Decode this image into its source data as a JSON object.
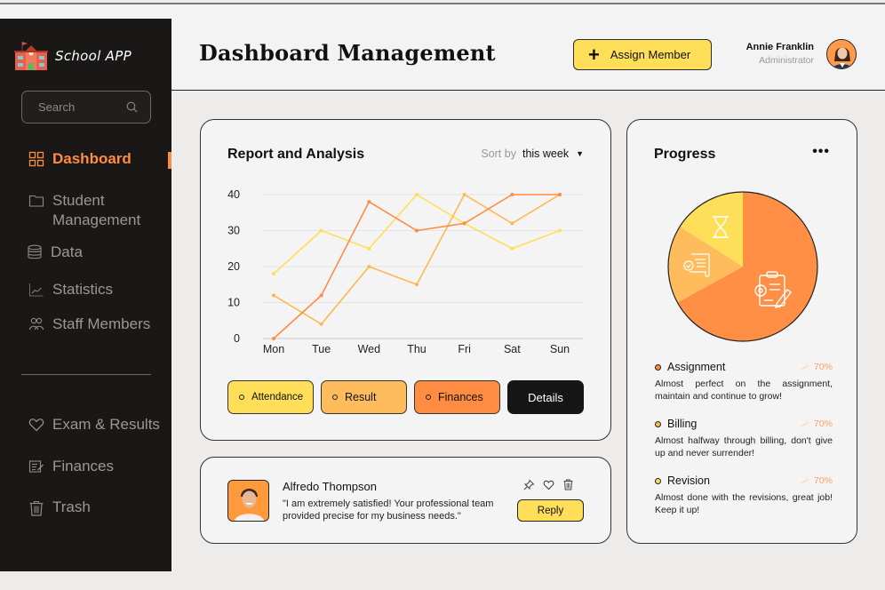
{
  "app": {
    "name": "School APP"
  },
  "sidebar": {
    "search_placeholder": "Search",
    "items": [
      {
        "label": "Dashboard",
        "icon": "grid-icon",
        "active": true
      },
      {
        "label": "Student Management",
        "icon": "folder-icon"
      },
      {
        "label": "Data",
        "icon": "database-icon"
      },
      {
        "label": "Statistics",
        "icon": "chart-icon"
      },
      {
        "label": "Staff Members",
        "icon": "users-icon"
      }
    ],
    "bottom_items": [
      {
        "label": "Exam & Results",
        "icon": "heart-icon"
      },
      {
        "label": "Finances",
        "icon": "edit-doc-icon"
      },
      {
        "label": "Trash",
        "icon": "trash-icon"
      }
    ]
  },
  "header": {
    "title": "Dashboard Management",
    "assign_button": "Assign Member",
    "user": {
      "name": "Annie Franklin",
      "role": "Administrator"
    }
  },
  "report": {
    "title": "Report and Analysis",
    "sort_label": "Sort by",
    "sort_value": "this week",
    "legend": [
      "Attendance",
      "Result",
      "Finances"
    ],
    "details_button": "Details"
  },
  "chart_data": {
    "type": "line",
    "title": "Report and Analysis",
    "xlabel": "",
    "ylabel": "",
    "categories": [
      "Mon",
      "Tue",
      "Wed",
      "Thu",
      "Fri",
      "Sat",
      "Sun"
    ],
    "ylim": [
      0,
      40
    ],
    "yticks": [
      0,
      10,
      20,
      30,
      40
    ],
    "grid": true,
    "legend": "bottom",
    "series": [
      {
        "name": "Attendance",
        "color": "#ffde59",
        "values": [
          18,
          30,
          25,
          40,
          32,
          25,
          30
        ]
      },
      {
        "name": "Result",
        "color": "#ffb752",
        "values": [
          12,
          4,
          20,
          15,
          40,
          32,
          40
        ]
      },
      {
        "name": "Finances",
        "color": "#ff8c42",
        "values": [
          0,
          12,
          38,
          30,
          32,
          40,
          40
        ]
      }
    ]
  },
  "review": {
    "name": "Alfredo Thompson",
    "text": "\"I am extremely satisfied! Your professional team provided precise for my business needs.\"",
    "reply_button": "Reply"
  },
  "progress": {
    "title": "Progress",
    "pie": [
      {
        "name": "Assignment",
        "share": 0.67,
        "color": "#ff8f45"
      },
      {
        "name": "Billing",
        "share": 0.17,
        "color": "#ffbc5c"
      },
      {
        "name": "Revision",
        "share": 0.16,
        "color": "#ffde59"
      }
    ],
    "items": [
      {
        "title": "Assignment",
        "percent": "70%",
        "color": "#ff8c42",
        "desc": "Almost perfect on the assignment, maintain and continue to grow!"
      },
      {
        "title": "Billing",
        "percent": "70%",
        "color": "#ffb752",
        "desc": "Almost halfway through billing, don't give up and never surrender!"
      },
      {
        "title": "Revision",
        "percent": "70%",
        "color": "#ffde59",
        "desc": "Almost done with the revisions, great job! Keep it up!"
      }
    ]
  },
  "colors": {
    "accent": "#ff8c42",
    "yellow": "#ffde59",
    "sidebar_bg": "#1a1817"
  }
}
